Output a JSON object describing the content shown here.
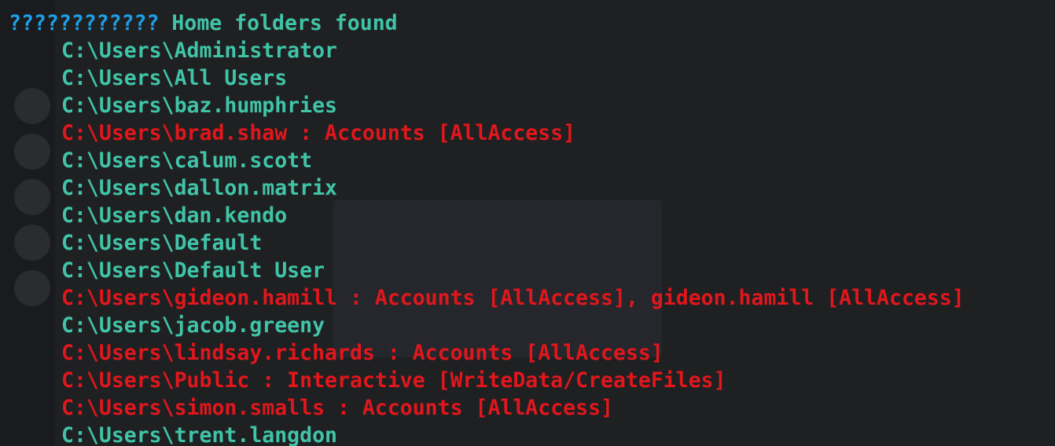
{
  "terminal": {
    "header": {
      "prefix": "????????????",
      "title": "Home folders found"
    },
    "entries": [
      {
        "text": "C:\\Users\\Administrator",
        "status": "normal"
      },
      {
        "text": "C:\\Users\\All Users",
        "status": "normal"
      },
      {
        "text": "C:\\Users\\baz.humphries",
        "status": "normal"
      },
      {
        "text": "C:\\Users\\brad.shaw : Accounts [AllAccess]",
        "status": "flag"
      },
      {
        "text": "C:\\Users\\calum.scott",
        "status": "normal"
      },
      {
        "text": "C:\\Users\\dallon.matrix",
        "status": "normal"
      },
      {
        "text": "C:\\Users\\dan.kendo",
        "status": "normal"
      },
      {
        "text": "C:\\Users\\Default",
        "status": "normal"
      },
      {
        "text": "C:\\Users\\Default User",
        "status": "normal"
      },
      {
        "text": "C:\\Users\\gideon.hamill : Accounts [AllAccess], gideon.hamill [AllAccess]",
        "status": "flag"
      },
      {
        "text": "C:\\Users\\jacob.greeny",
        "status": "normal"
      },
      {
        "text": "C:\\Users\\lindsay.richards : Accounts [AllAccess]",
        "status": "flag"
      },
      {
        "text": "C:\\Users\\Public : Interactive [WriteData/CreateFiles]",
        "status": "flag"
      },
      {
        "text": "C:\\Users\\simon.smalls : Accounts [AllAccess]",
        "status": "flag"
      },
      {
        "text": "C:\\Users\\trent.langdon",
        "status": "normal"
      }
    ]
  },
  "colors": {
    "background": "#1f2022",
    "header_prefix": "#1e9fe8",
    "normal": "#40c4a8",
    "flag": "#e0171c"
  }
}
